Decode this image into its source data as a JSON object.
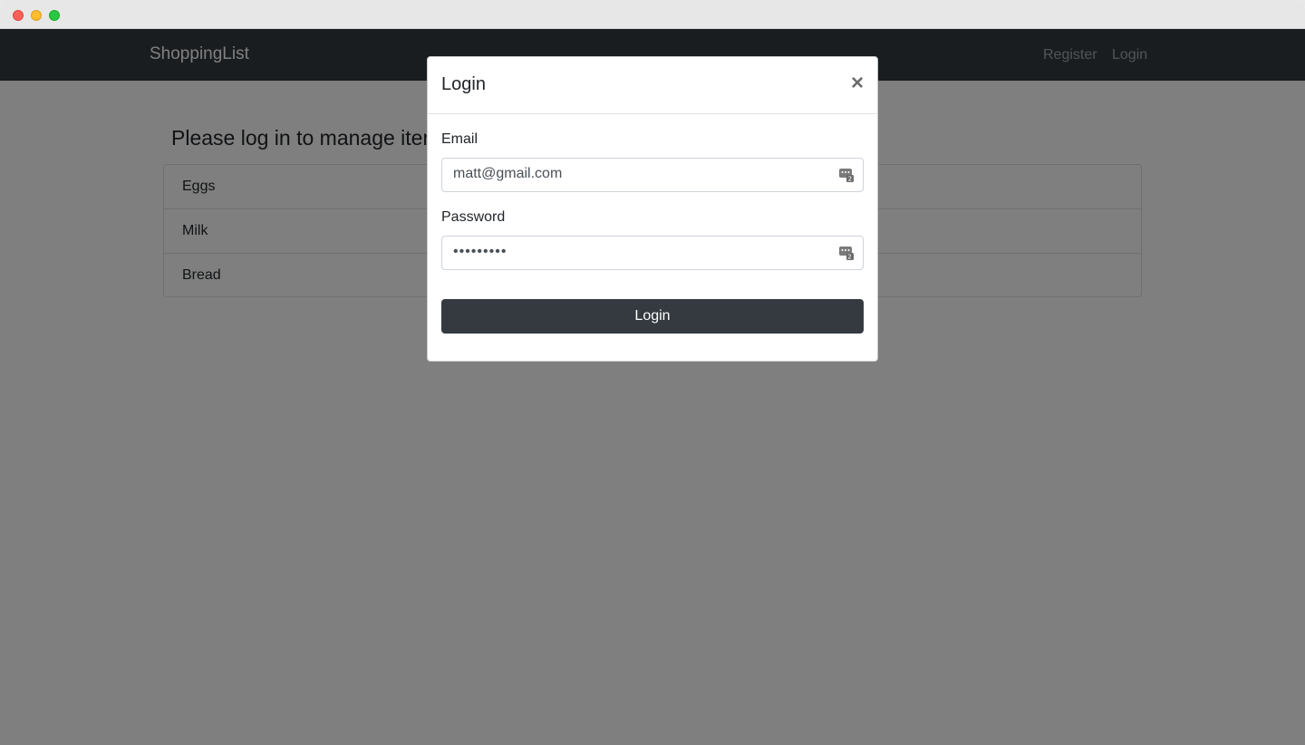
{
  "app": {
    "brand": "ShoppingList"
  },
  "nav": {
    "register": "Register",
    "login": "Login"
  },
  "page": {
    "heading": "Please log in to manage items",
    "items": [
      "Eggs",
      "Milk",
      "Bread"
    ]
  },
  "modal": {
    "title": "Login",
    "close": "×",
    "email_label": "Email",
    "email_value": "matt@gmail.com",
    "password_label": "Password",
    "password_value": "•••••••••",
    "submit_label": "Login"
  },
  "icons": {
    "traffic_close": "close-window-icon",
    "traffic_min": "minimize-window-icon",
    "traffic_max": "maximize-window-icon",
    "autofill": "password-manager-icon"
  },
  "colors": {
    "navbar": "#343a40",
    "button": "#343a40",
    "backdrop": "rgba(0,0,0,0.5)"
  }
}
